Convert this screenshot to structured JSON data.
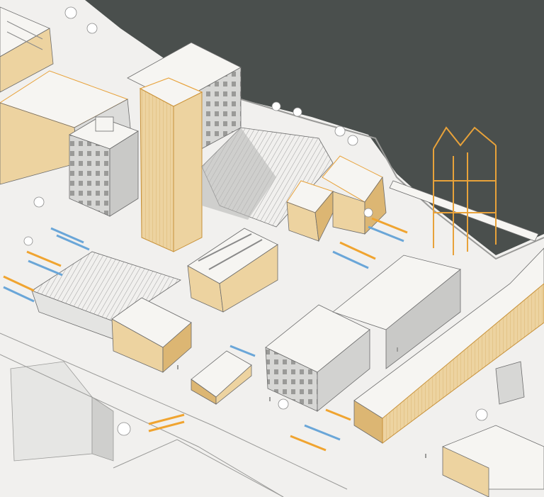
{
  "palette": {
    "ground": "#f1f0ee",
    "water": "#4a4f4d",
    "roof": "#f6f5f2",
    "wall_grey": "#d9d9d7",
    "wall_dark": "#bdbdbb",
    "timber": "#edd3a0",
    "timber_dark": "#dcb673",
    "accent_orange": "#f0a430",
    "accent_blue": "#6aa6d8",
    "line": "#6b6b6b"
  },
  "icons": [
    "tree-icon",
    "person-icon",
    "bench-icon"
  ]
}
